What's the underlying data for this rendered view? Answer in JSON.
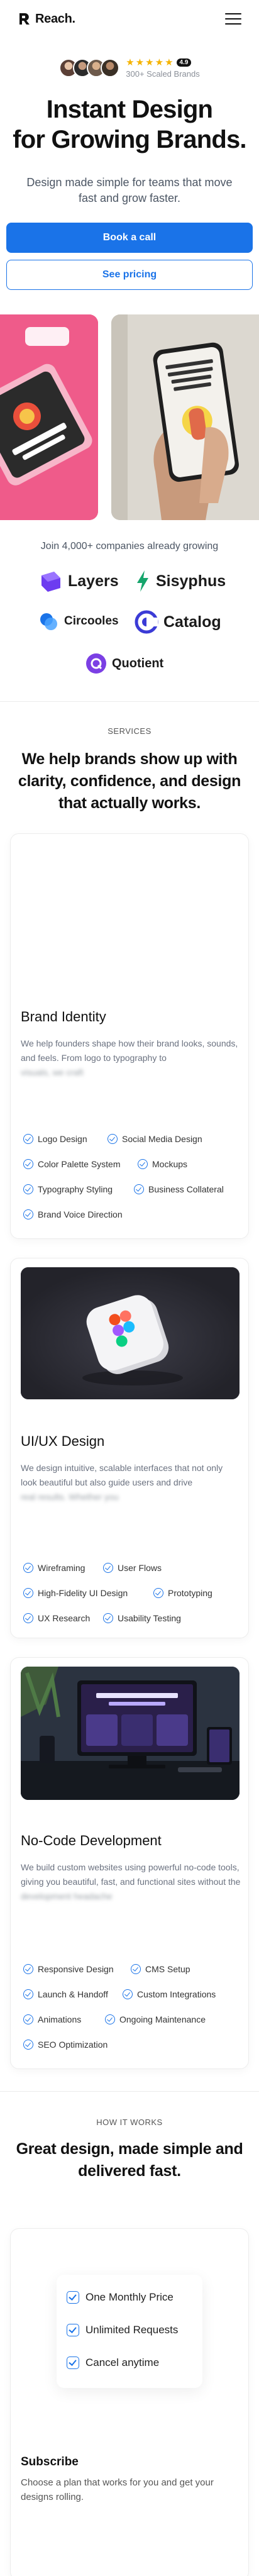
{
  "header": {
    "logo_text": "Reach.",
    "logo_icon": "reach-r-logo-icon",
    "menu_icon": "hamburger-menu-icon"
  },
  "hero": {
    "rating": "4.9",
    "scaled_brands": "300+ Scaled Brands",
    "title_line1": "Instant Design",
    "title_line2": "for Growing Brands.",
    "subtitle": "Design made simple for teams that move fast and grow faster.",
    "primary_button": "Book a call",
    "secondary_button": "See pricing"
  },
  "companies": {
    "heading": "Join 4,000+ companies already growing",
    "logos": [
      "Layers",
      "Sisyphus",
      "Circooles",
      "Catalog",
      "Quotient"
    ]
  },
  "services": {
    "eyebrow": "SERVICES",
    "heading": "We help brands show up with clarity, confidence, and design that actually works.",
    "cards": [
      {
        "title": "Brand Identity",
        "desc": "We help founders shape how their brand looks, sounds, and feels. From logo to typography to",
        "desc_blurred": "visuals, we craft",
        "tags": [
          "Logo Design",
          "Social Media Design",
          "Color Palette System",
          "Mockups",
          "Typography Styling",
          "Business Collateral",
          "Brand Voice Direction"
        ]
      },
      {
        "title": "UI/UX Design",
        "desc": "We design intuitive, scalable interfaces that not only look beautiful but also guide users and drive",
        "desc_blurred": "real results. Whether you",
        "tags": [
          "Wireframing",
          "User Flows",
          "High-Fidelity UI Design",
          "Prototyping",
          "UX Research",
          "Usability Testing"
        ]
      },
      {
        "title": "No-Code Development",
        "desc": "We build custom websites using powerful no-code tools, giving you beautiful, fast, and functional sites without the",
        "desc_blurred": "development headache",
        "tags": [
          "Responsive Design",
          "CMS Setup",
          "Launch & Handoff",
          "Custom Integrations",
          "Animations",
          "Ongoing Maintenance",
          "SEO Optimization"
        ]
      }
    ]
  },
  "how_it_works": {
    "eyebrow": "HOW IT WORKS",
    "heading": "Great design, made simple and delivered fast.",
    "checklist": [
      "One Monthly Price",
      "Unlimited Requests",
      "Cancel anytime"
    ],
    "step_title": "Subscribe",
    "step_desc": "Choose a plan that works for you and get your designs rolling."
  },
  "colors": {
    "accent": "#1a73e8",
    "star": "#f5b300"
  }
}
